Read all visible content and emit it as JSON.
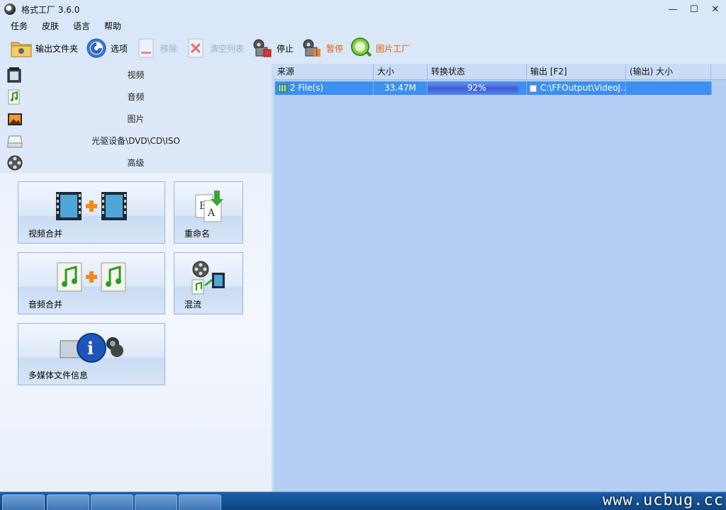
{
  "window": {
    "title": "格式工厂 3.6.0",
    "controls": [
      "—",
      "☐",
      "✕"
    ]
  },
  "menu": [
    "任务",
    "皮肤",
    "语言",
    "帮助"
  ],
  "toolbar": [
    {
      "label": "输出文件夹",
      "icon": "folder-icon",
      "enabled": true
    },
    {
      "label": "选项",
      "icon": "options-icon",
      "enabled": true
    },
    {
      "label": "移除",
      "icon": "remove-icon",
      "enabled": false
    },
    {
      "label": "清空列表",
      "icon": "clear-list-icon",
      "enabled": false
    },
    {
      "label": "停止",
      "icon": "stop-icon",
      "enabled": true
    },
    {
      "label": "暂停",
      "icon": "pause-icon",
      "enabled": true
    },
    {
      "label": "图片工厂",
      "icon": "picture-factory-icon",
      "enabled": true
    }
  ],
  "categories": [
    {
      "label": "视频",
      "icon": "film-icon"
    },
    {
      "label": "音频",
      "icon": "music-icon"
    },
    {
      "label": "图片",
      "icon": "picture-icon"
    },
    {
      "label": "光驱设备\\DVD\\CD\\ISO",
      "icon": "disc-drive-icon"
    },
    {
      "label": "高级",
      "icon": "film-reel-icon"
    }
  ],
  "tiles": [
    {
      "label": "视频合并",
      "icon": "video-merge-icon"
    },
    {
      "label": "重命名",
      "icon": "rename-icon"
    },
    {
      "label": "音频合并",
      "icon": "audio-merge-icon"
    },
    {
      "label": "混流",
      "icon": "mux-icon"
    },
    {
      "label": "多媒体文件信息",
      "icon": "media-info-icon"
    }
  ],
  "table": {
    "columns": [
      "来源",
      "大小",
      "转换状态",
      "输出 [F2]",
      "(输出) 大小"
    ],
    "rows": [
      {
        "source": "2 File(s)",
        "size": "33.47M",
        "status": "92%",
        "progress": 0.92,
        "output": "C:\\FFOutput\\VideoJ...",
        "out_size": ""
      }
    ]
  },
  "taskbar": {
    "watermark": "www.ucbug.cc"
  },
  "colors": {
    "accent": "#3d8ff0",
    "progress": "#3c5fd6",
    "toolbar_orange": "#e0600a"
  }
}
